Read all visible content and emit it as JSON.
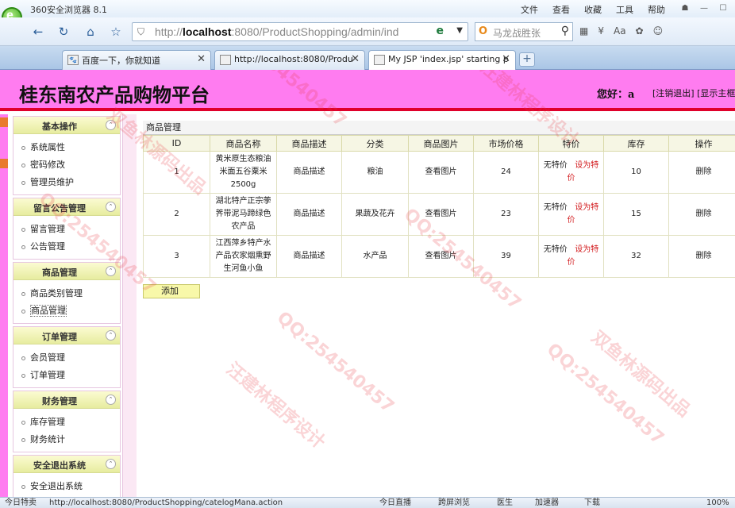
{
  "browser": {
    "app_title": "360安全浏览器 8.1",
    "menu": [
      "文件",
      "查看",
      "收藏",
      "工具",
      "帮助"
    ],
    "address": {
      "prefix": "http://",
      "host": "localhost",
      "rest": ":8080/ProductShopping/admin/ind"
    },
    "search_text": "马龙战胜张",
    "tabs": [
      {
        "label": "百度一下，你就知道",
        "icon": "paw-icon"
      },
      {
        "label": "http://localhost:8080/Produ",
        "icon": "page-icon"
      },
      {
        "label": "My JSP 'index.jsp' starting p",
        "icon": "page-icon",
        "active": true
      }
    ]
  },
  "header": {
    "site_title": "桂东南农产品购物平台",
    "greeting": "您好：a",
    "links": "[注销退出] [显示主框"
  },
  "sidebar": {
    "groups": [
      {
        "title": "基本操作",
        "items": [
          "系统属性",
          "密码修改",
          "管理员维护"
        ]
      },
      {
        "title": "留言公告管理",
        "items": [
          "留言管理",
          "公告管理"
        ]
      },
      {
        "title": "商品管理",
        "items": [
          "商品类别管理",
          "商品管理"
        ]
      },
      {
        "title": "订单管理",
        "items": [
          "会员管理",
          "订单管理"
        ]
      },
      {
        "title": "财务管理",
        "items": [
          "库存管理",
          "财务统计"
        ]
      },
      {
        "title": "安全退出系统",
        "items": [
          "安全退出系统"
        ]
      }
    ]
  },
  "main": {
    "section_title": "商品管理",
    "columns": [
      "ID",
      "商品名称",
      "商品描述",
      "分类",
      "商品图片",
      "市场价格",
      "特价",
      "库存",
      "操作"
    ],
    "rows": [
      {
        "id": "1",
        "name": "黄米原生态粮油米面五谷粟米2500g",
        "desc": "商品描述",
        "category": "粮油",
        "image": "查看图片",
        "price": "24",
        "special": "无特价",
        "set_special": "设为特价",
        "stock": "10",
        "action": "删除"
      },
      {
        "id": "2",
        "name": "湖北特产正宗荸荠带泥马蹄绿色农产品",
        "desc": "商品描述",
        "category": "果蔬及花卉",
        "image": "查看图片",
        "price": "23",
        "special": "无特价",
        "set_special": "设为特价",
        "stock": "15",
        "action": "删除"
      },
      {
        "id": "3",
        "name": "江西萍乡特产水产品农家烟熏野生河鱼小鱼",
        "desc": "商品描述",
        "category": "水产品",
        "image": "查看图片",
        "price": "39",
        "special": "无特价",
        "set_special": "设为特价",
        "stock": "32",
        "action": "删除"
      }
    ],
    "add_button": "添加"
  },
  "statusbar": {
    "left": "今日特卖",
    "url": "http://localhost:8080/ProductShopping/catelogMana.action",
    "items": [
      "今日直播",
      "跨屏浏览",
      "医生",
      "加速器",
      "下载"
    ],
    "zoom": "100%"
  },
  "watermarks": [
    "QQ:254540457",
    "汪建林程序设计",
    "双鱼林源码出品"
  ]
}
